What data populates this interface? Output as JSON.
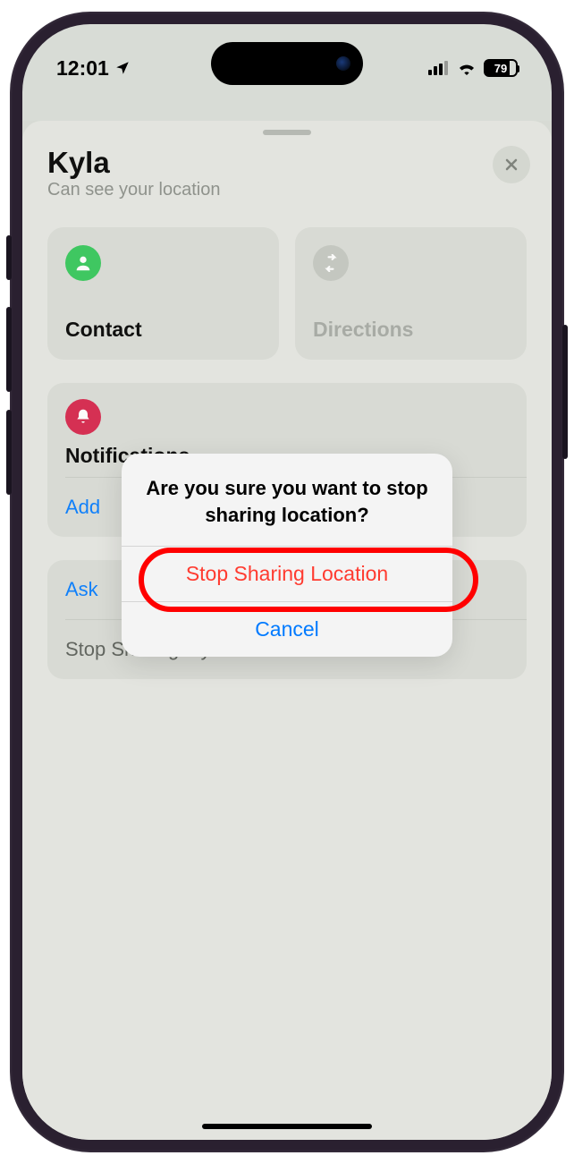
{
  "status": {
    "time": "12:01",
    "battery": "79"
  },
  "sheet": {
    "name": "Kyla",
    "subtitle": "Can see your location"
  },
  "tiles": {
    "contact": "Contact",
    "directions": "Directions"
  },
  "notifications": {
    "title": "Notifications",
    "add": "Add",
    "ask": "Ask"
  },
  "stop_row": "Stop Sharing My Location",
  "alert": {
    "title": "Are you sure you want to stop sharing location?",
    "destructive": "Stop Sharing Location",
    "cancel": "Cancel"
  }
}
